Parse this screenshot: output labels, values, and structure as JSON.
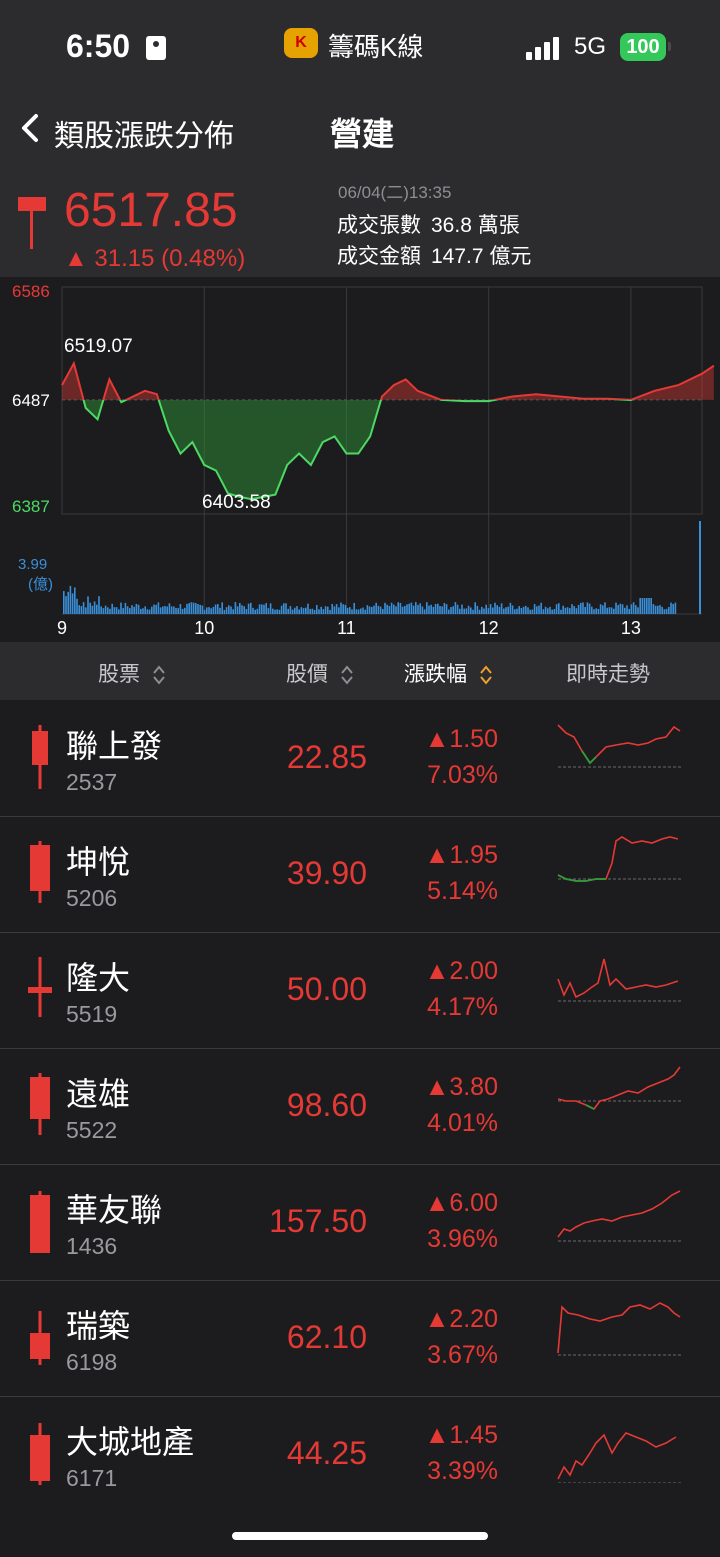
{
  "status_bar": {
    "time": "6:50",
    "app_name": "籌碼K線",
    "network": "5G",
    "battery": "100"
  },
  "nav": {
    "back_label": "類股漲跌分佈",
    "title": "營建"
  },
  "quote": {
    "price": "6517.85",
    "change": "▲ 31.15 (0.48%)",
    "datetime": "06/04(二)13:35",
    "volume_label": "成交張數",
    "volume_value": "36.8 萬張",
    "amount_label": "成交金額",
    "amount_value": "147.7 億元"
  },
  "colors": {
    "up": "#e53935",
    "down": "#2e9e3a",
    "volume": "#3a8fd9"
  },
  "chart_data": {
    "type": "line",
    "y_high_label": "6586",
    "y_ref_label": "6487",
    "y_low_label": "6387",
    "ylim": [
      6387,
      6586
    ],
    "reference": 6487,
    "annotation_high": "6519.07",
    "annotation_low": "6403.58",
    "volume_max_label": "3.99",
    "volume_unit_label": "(億)",
    "x_ticks": [
      "9",
      "10",
      "11",
      "12",
      "13"
    ],
    "x": [
      "9:00",
      "9:05",
      "9:10",
      "9:15",
      "9:20",
      "9:25",
      "9:30",
      "9:35",
      "9:40",
      "9:45",
      "9:50",
      "9:55",
      "10:00",
      "10:05",
      "10:10",
      "10:15",
      "10:20",
      "10:25",
      "10:30",
      "10:35",
      "10:40",
      "10:45",
      "10:50",
      "10:55",
      "11:00",
      "11:05",
      "11:10",
      "11:15",
      "11:20",
      "11:25",
      "11:30",
      "11:40",
      "11:50",
      "12:00",
      "12:10",
      "12:20",
      "12:30",
      "12:40",
      "12:50",
      "13:00",
      "13:10",
      "13:20",
      "13:25",
      "13:30",
      "13:35"
    ],
    "values": [
      6500,
      6519,
      6480,
      6470,
      6505,
      6485,
      6490,
      6495,
      6492,
      6460,
      6440,
      6450,
      6430,
      6425,
      6405,
      6402,
      6400,
      6402,
      6404,
      6430,
      6440,
      6430,
      6450,
      6455,
      6440,
      6440,
      6455,
      6490,
      6500,
      6505,
      6495,
      6487,
      6486,
      6486,
      6490,
      6492,
      6490,
      6488,
      6488,
      6487,
      6495,
      6500,
      6505,
      6510,
      6517
    ]
  },
  "list_header": {
    "stock": "股票",
    "price": "股價",
    "change": "漲跌幅",
    "trend": "即時走勢"
  },
  "stocks": [
    {
      "name": "聯上發",
      "code": "2537",
      "price": "22.85",
      "change": "▲1.50",
      "pct": "7.03%"
    },
    {
      "name": "坤悅",
      "code": "5206",
      "price": "39.90",
      "change": "▲1.95",
      "pct": "5.14%"
    },
    {
      "name": "隆大",
      "code": "5519",
      "price": "50.00",
      "change": "▲2.00",
      "pct": "4.17%"
    },
    {
      "name": "遠雄",
      "code": "5522",
      "price": "98.60",
      "change": "▲3.80",
      "pct": "4.01%"
    },
    {
      "name": "華友聯",
      "code": "1436",
      "price": "157.50",
      "change": "▲6.00",
      "pct": "3.96%"
    },
    {
      "name": "瑞築",
      "code": "6198",
      "price": "62.10",
      "change": "▲2.20",
      "pct": "3.67%"
    },
    {
      "name": "大城地產",
      "code": "6171",
      "price": "44.25",
      "change": "▲1.45",
      "pct": "3.39%"
    }
  ]
}
